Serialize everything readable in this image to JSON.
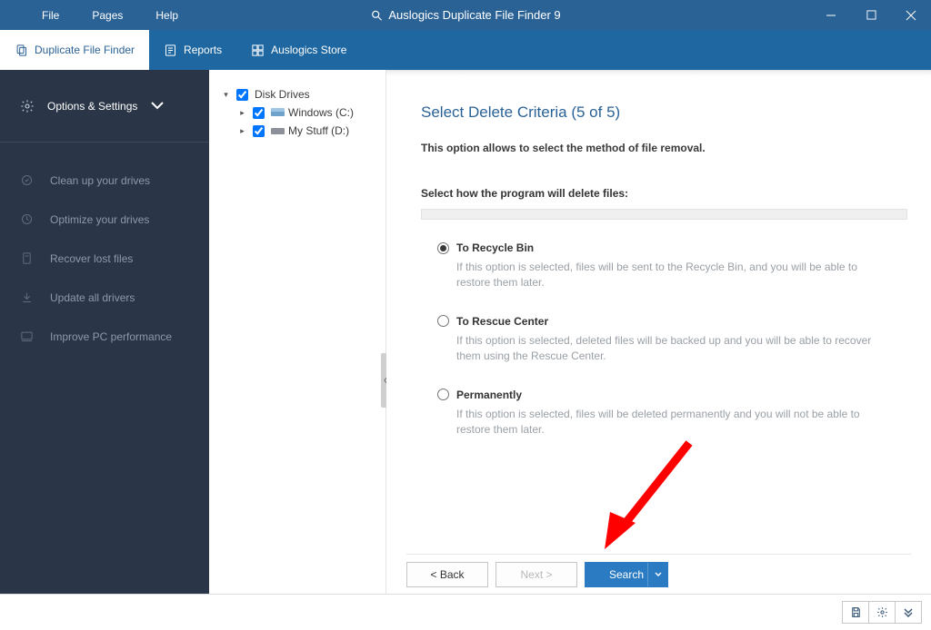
{
  "titlebar": {
    "menu": [
      "File",
      "Pages",
      "Help"
    ],
    "app_title": "Auslogics Duplicate File Finder 9"
  },
  "tabs": [
    {
      "label": "Duplicate File Finder",
      "active": true
    },
    {
      "label": "Reports",
      "active": false
    },
    {
      "label": "Auslogics Store",
      "active": false
    }
  ],
  "sidebar": {
    "options_label": "Options & Settings",
    "items": [
      "Clean up your drives",
      "Optimize your drives",
      "Recover lost files",
      "Update all drivers",
      "Improve PC performance"
    ]
  },
  "tree": {
    "root": "Disk Drives",
    "drives": [
      {
        "label": "Windows (C:)"
      },
      {
        "label": "My Stuff (D:)"
      }
    ]
  },
  "content": {
    "title": "Select Delete Criteria (5 of 5)",
    "subtitle": "This option allows to select the method of file removal.",
    "section_label": "Select how the program will delete files:",
    "options": [
      {
        "label": "To Recycle Bin",
        "desc": "If this option is selected, files will be sent to the Recycle Bin, and you will be able to restore them later.",
        "selected": true
      },
      {
        "label": "To Rescue Center",
        "desc": "If this option is selected, deleted files will be backed up and you will be able to recover them using the Rescue Center.",
        "selected": false
      },
      {
        "label": "Permanently",
        "desc": "If this option is selected, files will be deleted permanently and you will not be able to restore them later.",
        "selected": false
      }
    ],
    "buttons": {
      "back": "< Back",
      "next": "Next >",
      "search": "Search"
    }
  }
}
